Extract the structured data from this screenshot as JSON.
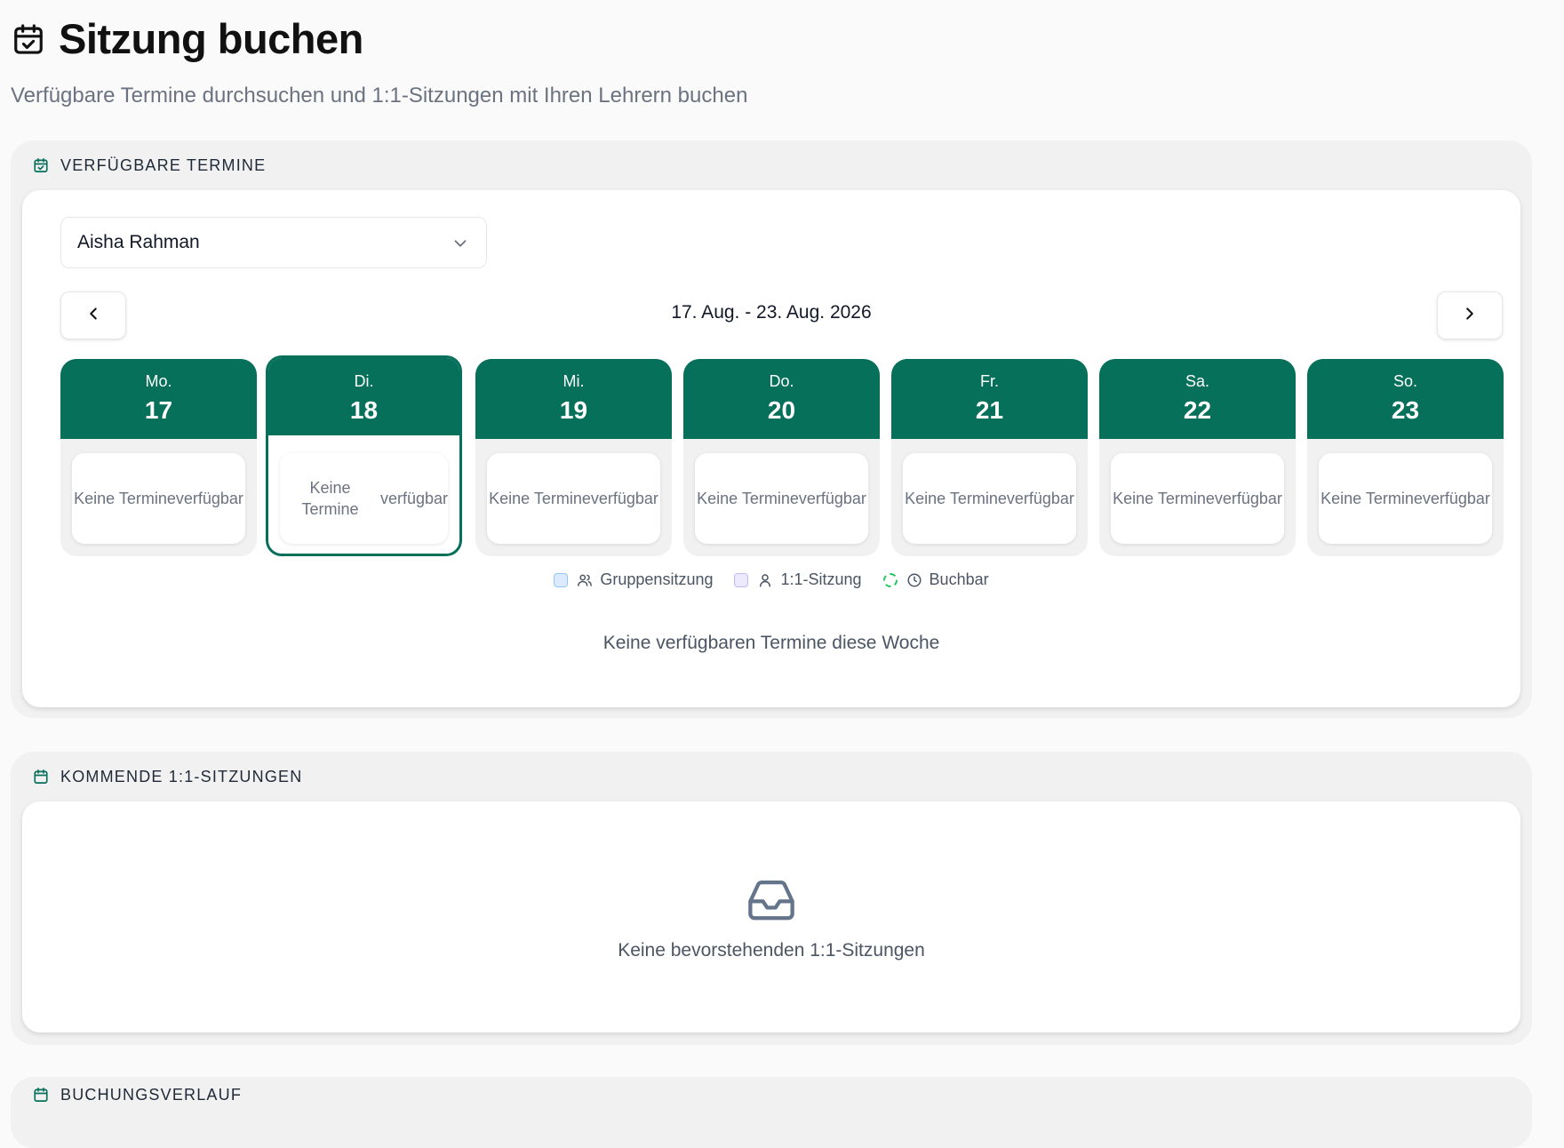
{
  "page": {
    "title": "Sitzung buchen",
    "subtitle": "Verfügbare Termine durchsuchen und 1:1-Sitzungen mit Ihren Lehrern buchen",
    "title_icon": "calendar-check-icon"
  },
  "available": {
    "section_title": "VERFÜGBARE TERMINE",
    "section_icon": "calendar-check-icon",
    "teacher_select": {
      "value": "Aisha Rahman",
      "icon": "chevron-down-icon"
    },
    "week_range": "17. Aug. - 23. Aug. 2026",
    "prev_icon": "chevron-left-icon",
    "next_icon": "chevron-right-icon",
    "days": [
      {
        "name": "Mo.",
        "num": "17",
        "text": "Keine Termine verfügbar",
        "selected": false
      },
      {
        "name": "Di.",
        "num": "18",
        "text": "Keine Termine verfügbar",
        "selected": true
      },
      {
        "name": "Mi.",
        "num": "19",
        "text": "Keine Termine verfügbar",
        "selected": false
      },
      {
        "name": "Do.",
        "num": "20",
        "text": "Keine Termine verfügbar",
        "selected": false
      },
      {
        "name": "Fr.",
        "num": "21",
        "text": "Keine Termine verfügbar",
        "selected": false
      },
      {
        "name": "Sa.",
        "num": "22",
        "text": "Keine Termine verfügbar",
        "selected": false
      },
      {
        "name": "So.",
        "num": "23",
        "text": "Keine Termine verfügbar",
        "selected": false
      }
    ],
    "legend": [
      {
        "label": "Gruppensitzung",
        "icon": "users-icon"
      },
      {
        "label": "1:1-Sitzung",
        "icon": "user-icon"
      },
      {
        "label": "Buchbar",
        "icon": "clock-icon"
      }
    ],
    "empty_text": "Keine verfügbaren Termine diese Woche"
  },
  "upcoming": {
    "section_title": "KOMMENDE 1:1-SITZUNGEN",
    "section_icon": "calendar-icon",
    "empty_icon": "inbox-icon",
    "empty_text": "Keine bevorstehenden 1:1-Sitzungen"
  },
  "history": {
    "section_title": "BUCHUNGSVERLAUF",
    "section_icon": "calendar-icon"
  },
  "colors": {
    "accent": "#06705a",
    "muted_text": "#6b7280"
  }
}
